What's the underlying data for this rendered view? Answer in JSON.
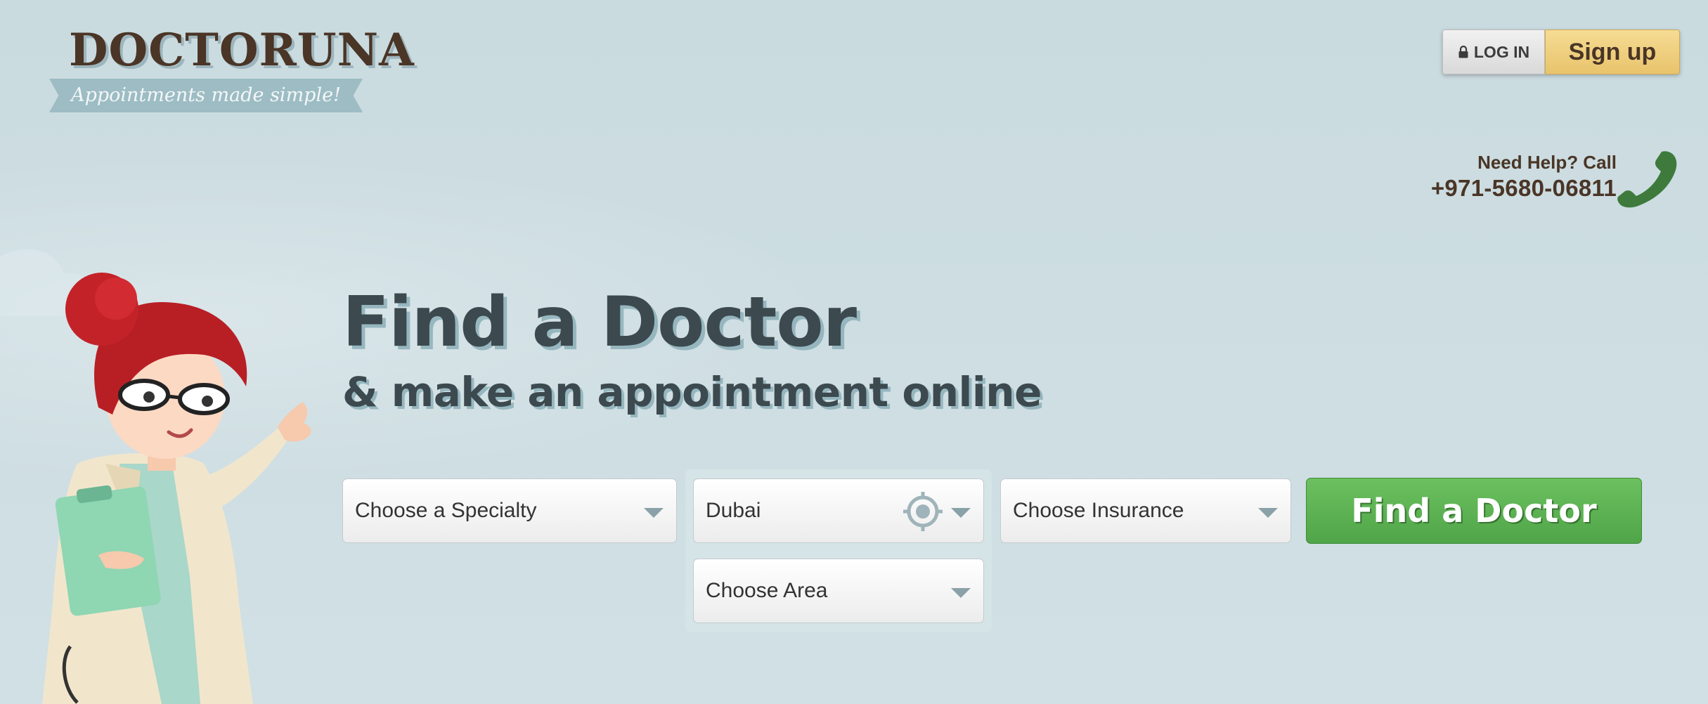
{
  "brand": {
    "name": "DOCTORUNA",
    "tagline": "Appointments made simple!"
  },
  "auth": {
    "login_label": "LOG IN",
    "signup_label": "Sign up"
  },
  "help": {
    "text": "Need Help? Call",
    "phone": "+971-5680-06811"
  },
  "hero": {
    "headline": "Find a Doctor",
    "subheadline": "& make an appointment online"
  },
  "search": {
    "specialty_label": "Choose a Specialty",
    "city_value": "Dubai",
    "area_label": "Choose Area",
    "insurance_label": "Choose Insurance",
    "submit_label": "Find a Doctor"
  },
  "colors": {
    "background": "#cfdee2",
    "brand_brown": "#4a3526",
    "headline": "#3c4a4f",
    "signup_gold": "#e8c36c",
    "find_green": "#5cb252",
    "phone_green": "#3d7a3c"
  },
  "icons": [
    "lock-icon",
    "phone-icon",
    "location-target-icon",
    "chevron-down-icon"
  ]
}
